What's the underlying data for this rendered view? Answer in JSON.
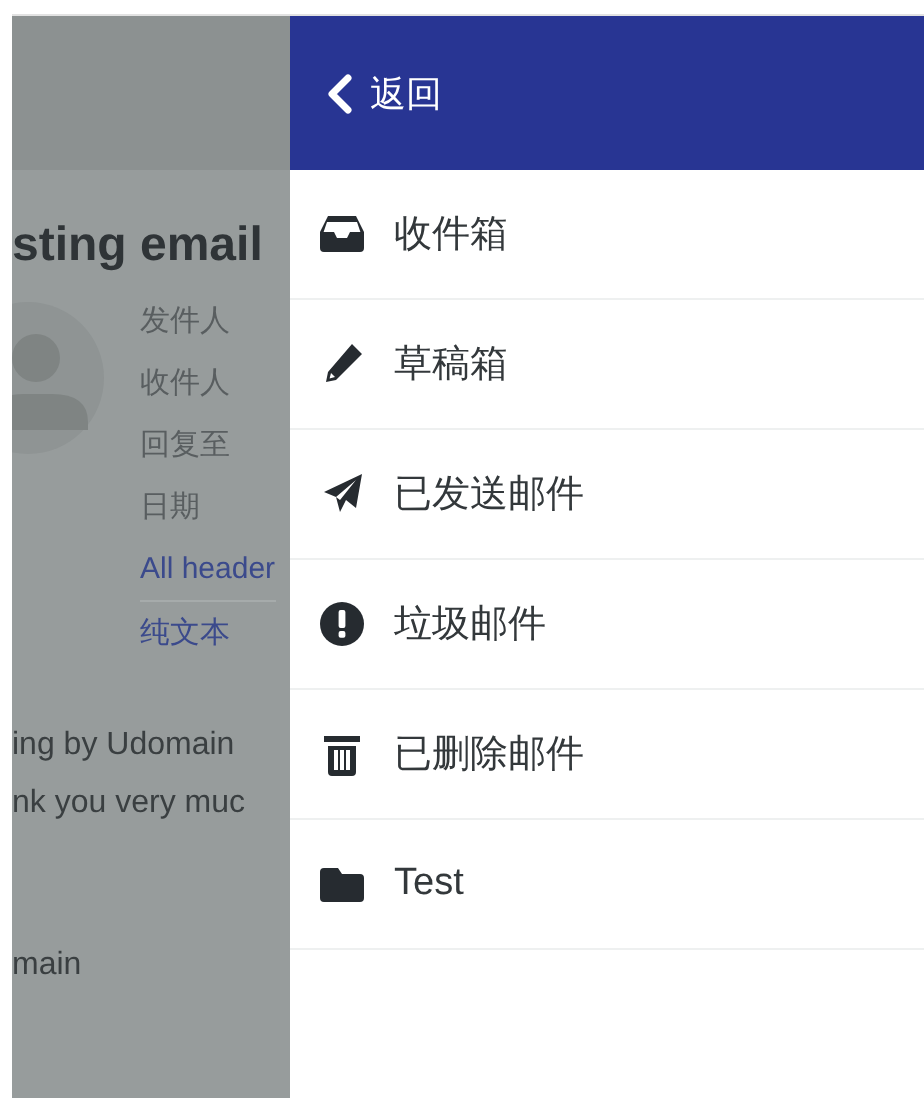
{
  "background_message": {
    "title": "sting email",
    "header_labels": [
      "发件人",
      "收件人",
      "回复至",
      "日期"
    ],
    "links": [
      "All header",
      "纯文本"
    ],
    "body_lines": [
      "ing by Udomain",
      "nk you very muc"
    ],
    "signature": "main"
  },
  "drawer": {
    "back_label": "返回",
    "folders": [
      {
        "kind": "inbox",
        "label": "收件箱"
      },
      {
        "kind": "drafts",
        "label": "草稿箱"
      },
      {
        "kind": "sent",
        "label": "已发送邮件"
      },
      {
        "kind": "junk",
        "label": "垃圾邮件"
      },
      {
        "kind": "trash",
        "label": "已删除邮件"
      },
      {
        "kind": "folder",
        "label": "Test"
      }
    ]
  }
}
